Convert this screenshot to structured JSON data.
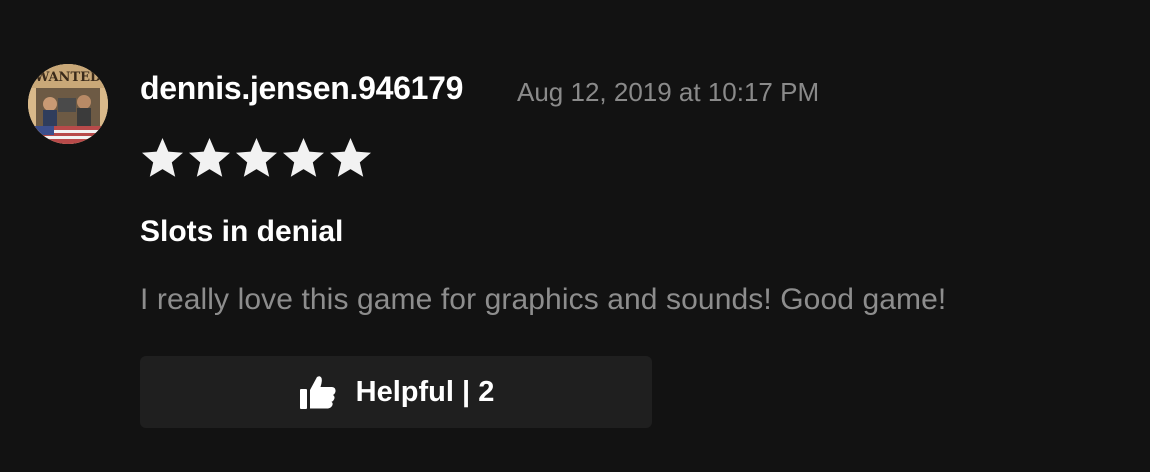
{
  "review": {
    "username": "dennis.jensen.946179",
    "date": "Aug 12, 2019 at 10:17 PM",
    "rating": 5,
    "rating_max": 5,
    "title": "Slots in denial",
    "body": "I really love this game for graphics and sounds! Good game!",
    "helpful": {
      "label": "Helpful",
      "separator": "|",
      "count": "2",
      "icon": "thumbs-up-icon"
    },
    "avatar": {
      "icon": "avatar-image",
      "text": "WANTED"
    }
  },
  "colors": {
    "background": "#121212",
    "button_background": "#1f1f1f",
    "text_primary": "#ffffff",
    "text_secondary": "#8a8a8a",
    "star": "#f2f2f2"
  }
}
